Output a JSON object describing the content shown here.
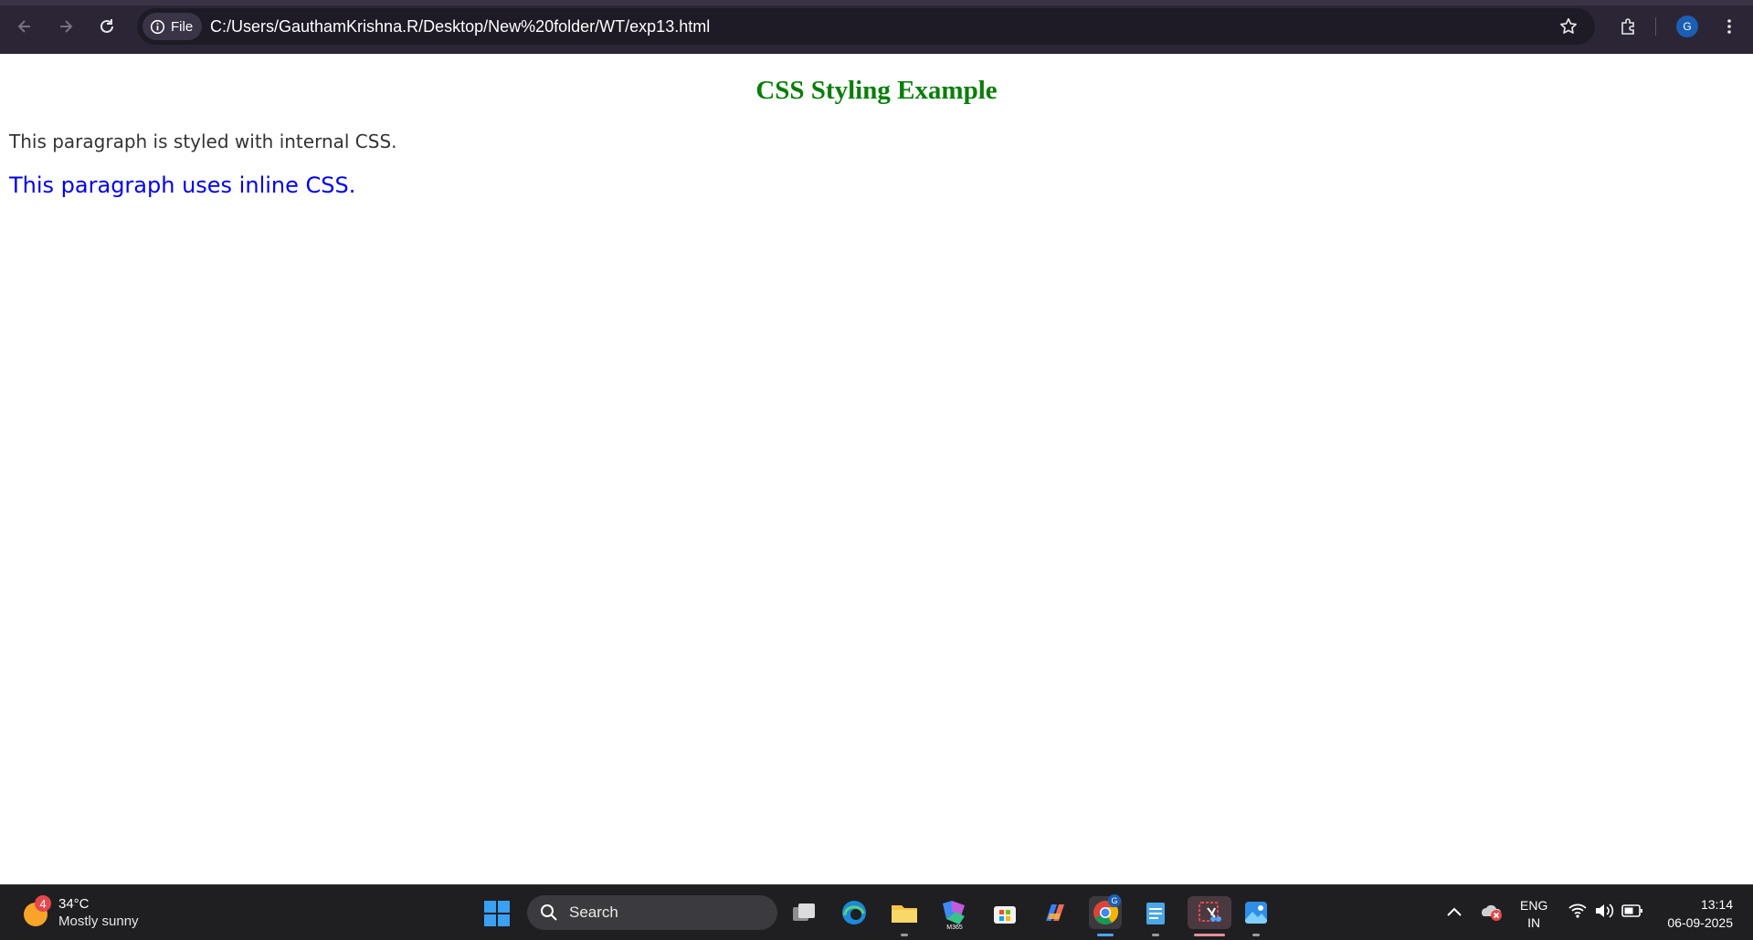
{
  "browser": {
    "chip_label": "File",
    "url": "C:/Users/GauthamKrishna.R/Desktop/New%20folder/WT/exp13.html",
    "profile_initial": "G",
    "icons": [
      "back-arrow-icon",
      "forward-arrow-icon",
      "reload-icon",
      "info-icon",
      "star-icon",
      "extensions-icon",
      "kebab-menu-icon"
    ]
  },
  "page": {
    "heading": "CSS Styling Example",
    "paragraph_internal": "This paragraph is styled with internal CSS.",
    "paragraph_inline": "This paragraph uses inline CSS.",
    "colors": {
      "heading": "#0a7d0a",
      "internal": "#333333",
      "inline": "#0000ee"
    }
  },
  "taskbar": {
    "weather": {
      "badge": "4",
      "temp": "34°C",
      "desc": "Mostly sunny"
    },
    "search_label": "Search",
    "apps": [
      "task-view-icon",
      "edge-icon",
      "file-explorer-icon",
      "m365-icon",
      "store-icon",
      "copilot-icon",
      "chrome-icon",
      "notepad-icon",
      "snipping-tool-icon",
      "photos-icon"
    ],
    "m365_text": "M365",
    "chrome_badge": "G",
    "lang_top": "ENG",
    "lang_bottom": "IN",
    "time": "13:14",
    "date": "06-09-2025"
  }
}
